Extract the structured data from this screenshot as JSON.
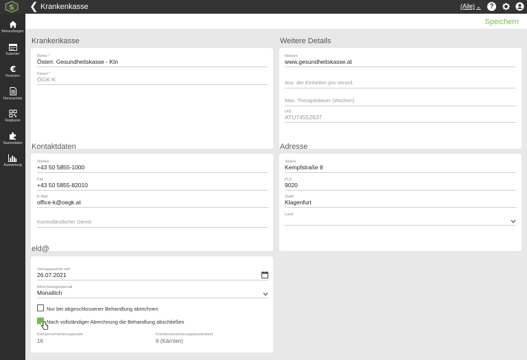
{
  "topbar": {
    "title": "Krankenkasse",
    "filter_label": "(Alle)"
  },
  "sidebar": {
    "items": [
      {
        "label": "Behandlungen",
        "icon": "home-icon"
      },
      {
        "label": "Kalender",
        "icon": "calendar-icon"
      },
      {
        "label": "Finanzen",
        "icon": "euro-icon"
      },
      {
        "label": "Honorarnote",
        "icon": "document-icon"
      },
      {
        "label": "Regkasse",
        "icon": "qr-icon"
      },
      {
        "label": "Stammdaten",
        "icon": "puzzle-icon"
      },
      {
        "label": "Auswertung",
        "icon": "bar-chart-icon"
      }
    ]
  },
  "actions": {
    "save_label": "Speichern"
  },
  "krankenkasse": {
    "section_title": "Krankenkasse",
    "name_label": "Name *",
    "name_value": "Österr. Gesundheitskasse - Ktn",
    "kuerzel_label": "Kürzel *",
    "kuerzel_value": "ÖGK-K"
  },
  "details": {
    "section_title": "Weitere Details",
    "notizen_label": "Notizen",
    "notizen_value": "www.gesundheitskasse.at",
    "einheiten_placeholder": "Anz. der Einheiten pro Verord.",
    "therapiedauer_placeholder": "Max. Therapiedauer (Wochen)",
    "uid_label": "UID",
    "uid_value": "ATU74552637"
  },
  "kontakt": {
    "section_title": "Kontaktdaten",
    "telefon_label": "Telefon",
    "telefon_value": "+43 50 5855-1000",
    "fax_label": "Fax",
    "fax_value": "+43 50 5855-82010",
    "email_label": "E-Mail",
    "email_value": "office-k@oegk.at",
    "kontrollarzt_placeholder": "Kontrollärztlicher Dienst"
  },
  "adresse": {
    "section_title": "Adresse",
    "strasse_label": "Straße",
    "strasse_value": "Kempfstraße  8",
    "plz_label": "PLZ",
    "plz_value": "9020",
    "stadt_label": "Stadt",
    "stadt_value": "Klagenfurt",
    "land_label": "Land"
  },
  "elda": {
    "section_title": "eld@",
    "vertrag_label": "Vertragspartner seit",
    "vertrag_value": "26.07.2021",
    "intervall_label": "Abrechnungsintervall",
    "intervall_value": "Monatlich",
    "check1_label": "Nur bei abgeschlossener Behandlung abrechnen",
    "check1_checked": false,
    "check2_label": "Nach vollständiger Abrechnung die Behandlung abschließen",
    "check2_checked": true,
    "code_label": "Krankenversicherungscode",
    "code_value": "16",
    "bundesland_label": "Krankenversicherungsbundesland",
    "bundesland_value": "6 (Kärnten)"
  },
  "colors": {
    "accent": "#6fbf4a",
    "topbar": "#333333",
    "sidebar": "#2d2d2d",
    "background": "#e8e8e8"
  }
}
